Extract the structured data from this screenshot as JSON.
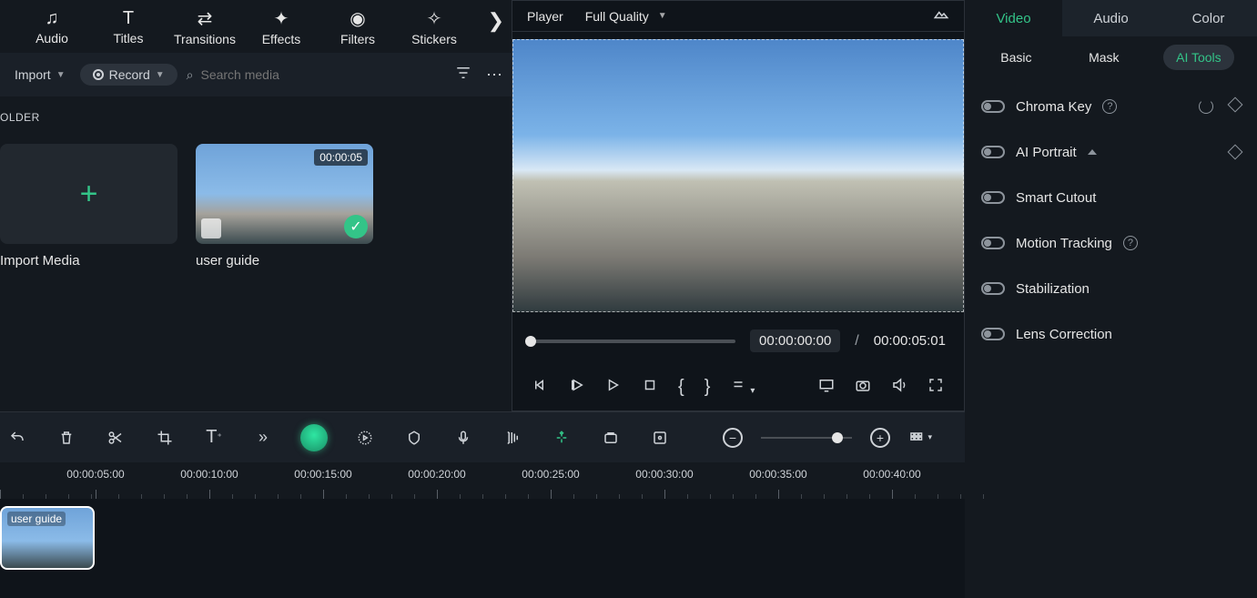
{
  "top_tabs": {
    "audio": "Audio",
    "titles": "Titles",
    "transitions": "Transitions",
    "effects": "Effects",
    "filters": "Filters",
    "stickers": "Stickers"
  },
  "media_toolbar": {
    "import": "Import",
    "record": "Record",
    "search_placeholder": "Search media"
  },
  "media_panel": {
    "folder_label": "OLDER",
    "import_card": "Import Media",
    "clip_name": "user guide",
    "clip_duration": "00:00:05"
  },
  "player": {
    "label": "Player",
    "quality": "Full Quality",
    "current_time": "00:00:00:00",
    "separator": "/",
    "duration": "00:00:05:01"
  },
  "inspector": {
    "tabs": {
      "video": "Video",
      "audio": "Audio",
      "color": "Color"
    },
    "subtabs": {
      "basic": "Basic",
      "mask": "Mask",
      "ai": "AI Tools"
    },
    "rows": {
      "chroma": "Chroma Key",
      "portrait": "AI Portrait",
      "cutout": "Smart Cutout",
      "motion": "Motion Tracking",
      "stab": "Stabilization",
      "lens": "Lens Correction"
    }
  },
  "ruler": {
    "t05": "00:00:05:00",
    "t10": "00:00:10:00",
    "t15": "00:00:15:00",
    "t20": "00:00:20:00",
    "t25": "00:00:25:00",
    "t30": "00:00:30:00",
    "t35": "00:00:35:00",
    "t40": "00:00:40:00"
  },
  "timeline": {
    "clip_label": "user guide"
  }
}
